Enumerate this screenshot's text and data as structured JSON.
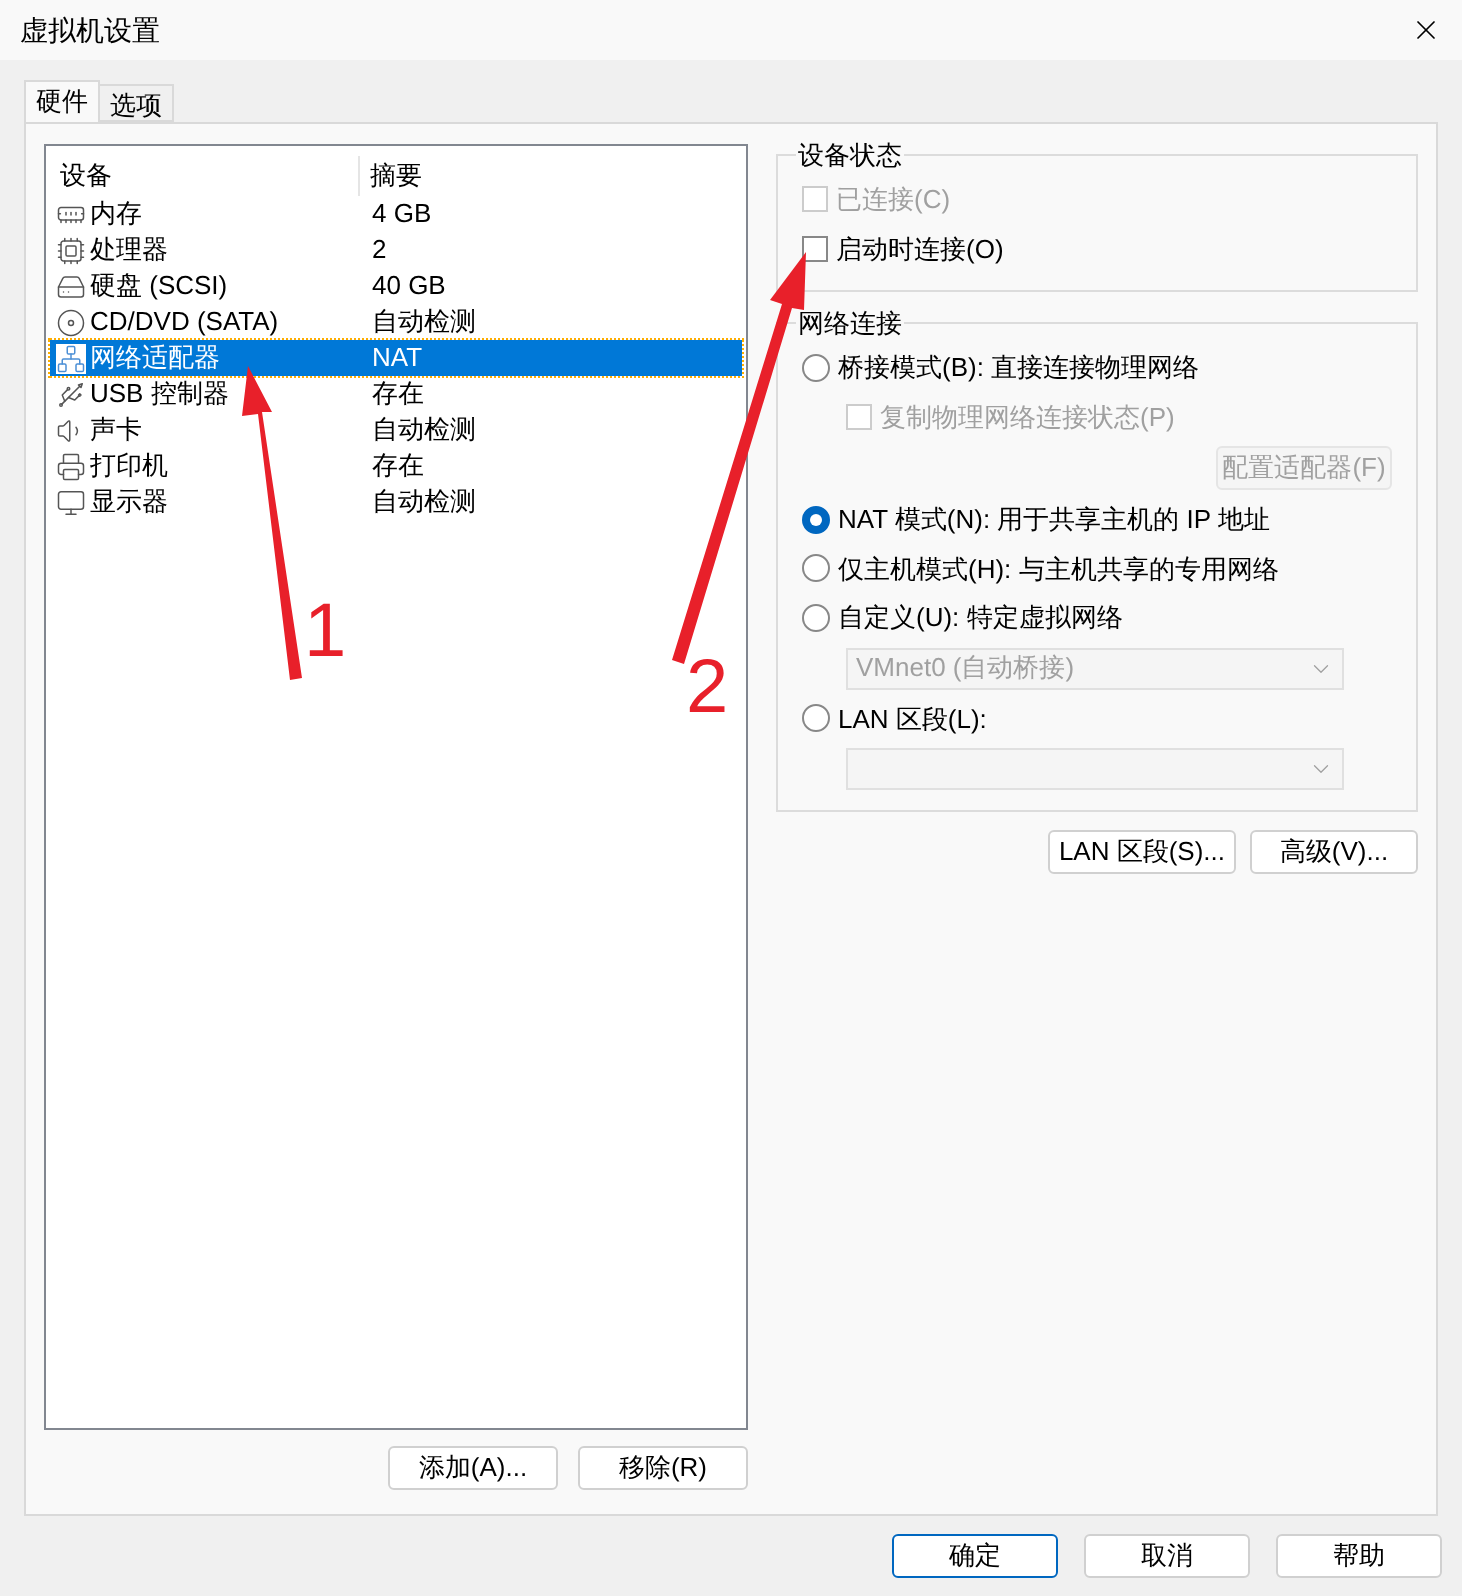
{
  "window": {
    "title": "虚拟机设置"
  },
  "tabs": [
    {
      "label": "硬件",
      "selected": true
    },
    {
      "label": "选项",
      "selected": false
    }
  ],
  "device_list": {
    "columns": [
      "设备",
      "摘要"
    ],
    "rows": [
      {
        "kind": "memory",
        "device": "内存",
        "summary": "4 GB",
        "selected": false
      },
      {
        "kind": "cpu",
        "device": "处理器",
        "summary": "2",
        "selected": false
      },
      {
        "kind": "disk",
        "device": "硬盘 (SCSI)",
        "summary": "40 GB",
        "selected": false
      },
      {
        "kind": "cd",
        "device": "CD/DVD (SATA)",
        "summary": "自动检测",
        "selected": false
      },
      {
        "kind": "network",
        "device": "网络适配器",
        "summary": "NAT",
        "selected": true
      },
      {
        "kind": "usb",
        "device": "USB 控制器",
        "summary": "存在",
        "selected": false
      },
      {
        "kind": "sound",
        "device": "声卡",
        "summary": "自动检测",
        "selected": false
      },
      {
        "kind": "printer",
        "device": "打印机",
        "summary": "存在",
        "selected": false
      },
      {
        "kind": "display",
        "device": "显示器",
        "summary": "自动检测",
        "selected": false
      }
    ]
  },
  "list_buttons": [
    "添加(A)...",
    "移除(R)"
  ],
  "device_status": {
    "title": "设备状态",
    "options": [
      {
        "label": "已连接(C)",
        "checked": false,
        "disabled": true
      },
      {
        "label": "启动时连接(O)",
        "checked": false,
        "disabled": false
      }
    ]
  },
  "network_connection": {
    "title": "网络连接",
    "items": [
      {
        "kind": "radio",
        "label": "桥接模式(B): 直接连接物理网络",
        "selected": false
      },
      {
        "kind": "checkbox",
        "label": "复制物理网络连接状态(P)",
        "checked": false,
        "disabled": true
      },
      {
        "kind": "button",
        "label": "配置适配器(F)",
        "disabled": true
      },
      {
        "kind": "radio",
        "label": "NAT 模式(N): 用于共享主机的 IP 地址",
        "selected": true
      },
      {
        "kind": "radio",
        "label": "仅主机模式(H): 与主机共享的专用网络",
        "selected": false
      },
      {
        "kind": "radio",
        "label": "自定义(U): 特定虚拟网络",
        "selected": false
      },
      {
        "kind": "dropdown",
        "value": "VMnet0 (自动桥接)",
        "disabled": true
      },
      {
        "kind": "radio",
        "label": "LAN 区段(L):",
        "selected": false
      },
      {
        "kind": "dropdown",
        "disabled": true
      }
    ]
  },
  "network_buttons": [
    "LAN 区段(S)...",
    "高级(V)..."
  ],
  "dialog_buttons": [
    {
      "label": "确定",
      "default": true
    },
    {
      "label": "取消",
      "default": false
    },
    {
      "label": "帮助",
      "default": false
    }
  ],
  "annotations": [
    {
      "label": "1"
    },
    {
      "label": "2"
    }
  ]
}
